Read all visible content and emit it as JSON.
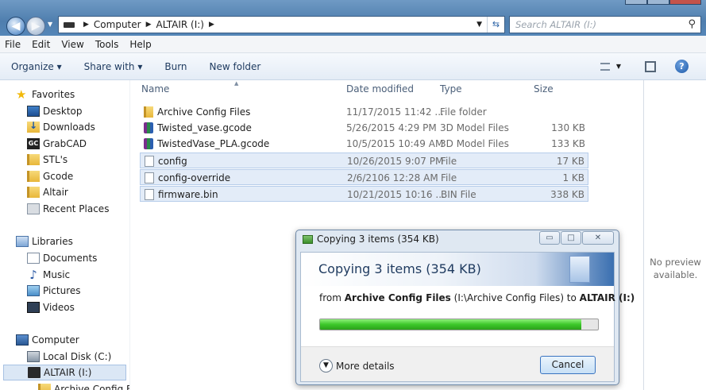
{
  "address": {
    "crumbs": [
      "Computer",
      "ALTAIR (I:)"
    ],
    "search_placeholder": "Search ALTAIR (I:)"
  },
  "menu": [
    "File",
    "Edit",
    "View",
    "Tools",
    "Help"
  ],
  "toolbar": {
    "organize": "Organize ▾",
    "share_with": "Share with ▾",
    "burn": "Burn",
    "new_folder": "New folder"
  },
  "nav": {
    "favorites": "Favorites",
    "desktop": "Desktop",
    "downloads": "Downloads",
    "grabcad": "GrabCAD",
    "stls": "STL's",
    "gcode": "Gcode",
    "altair": "Altair",
    "recent": "Recent Places",
    "libraries": "Libraries",
    "documents": "Documents",
    "music": "Music",
    "pictures": "Pictures",
    "videos": "Videos",
    "computer": "Computer",
    "local_disk": "Local Disk (C:)",
    "altair_drive": "ALTAIR (I:)",
    "archive_partial": "Archive Config Fil"
  },
  "columns": {
    "name": "Name",
    "date": "Date modified",
    "type": "Type",
    "size": "Size"
  },
  "files": [
    {
      "name": "Archive Config Files",
      "date": "11/17/2015 11:42 ...",
      "type": "File folder",
      "size": "",
      "icon": "folder-icon"
    },
    {
      "name": "Twisted_vase.gcode",
      "date": "5/26/2015 4:29 PM",
      "type": "3D Model Files",
      "size": "130 KB",
      "icon": "3d-model-icon"
    },
    {
      "name": "TwistedVase_PLA.gcode",
      "date": "10/5/2015 10:49 AM",
      "type": "3D Model Files",
      "size": "133 KB",
      "icon": "3d-model-icon"
    },
    {
      "name": "config",
      "date": "10/26/2015 9:07 PM",
      "type": "File",
      "size": "17 KB",
      "icon": "file-icon"
    },
    {
      "name": "config-override",
      "date": "2/6/2106 12:28 AM",
      "type": "File",
      "size": "1 KB",
      "icon": "file-icon"
    },
    {
      "name": "firmware.bin",
      "date": "10/21/2015 10:16 ...",
      "type": "BIN File",
      "size": "338 KB",
      "icon": "file-icon"
    }
  ],
  "preview": {
    "line1": "No preview",
    "line2": "available."
  },
  "dialog": {
    "title": "Copying 3 items (354 KB)",
    "heading": "Copying 3 items (354 KB)",
    "from_prefix": "from ",
    "from_source": "Archive Config Files",
    "from_source_path": " (I:\\Archive Config Files) to ",
    "from_dest": "ALTAIR (I:)",
    "progress_fraction": 0.94,
    "more_details": "More details",
    "cancel": "Cancel"
  }
}
